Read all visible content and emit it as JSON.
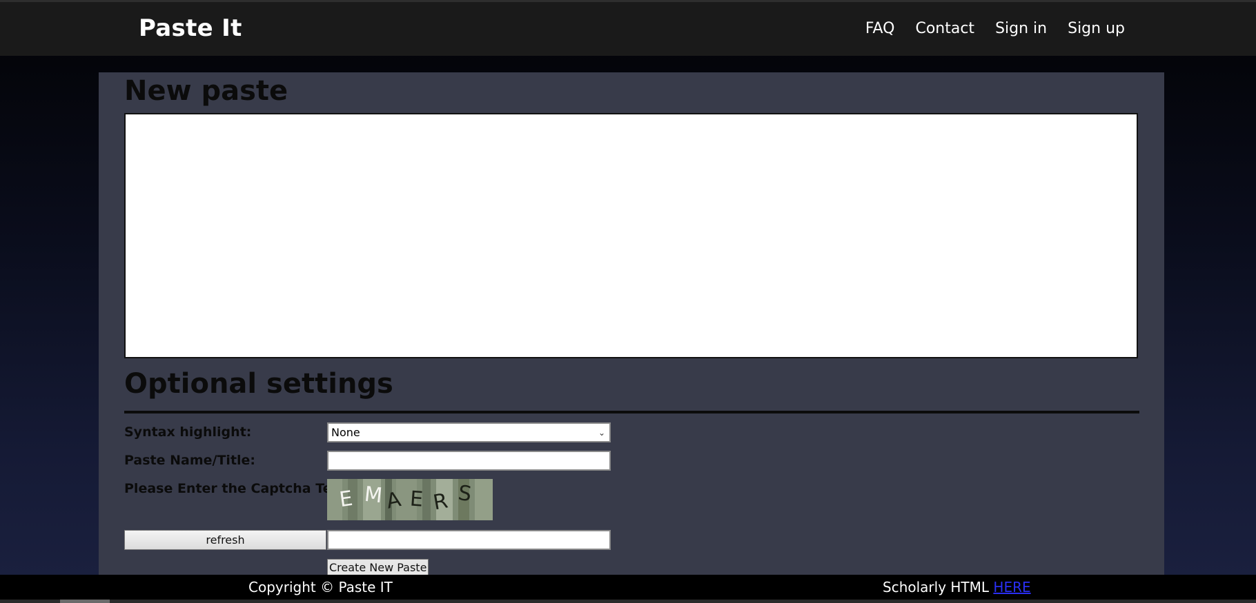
{
  "header": {
    "brand": "Paste It",
    "nav": [
      "FAQ",
      "Contact",
      "Sign in",
      "Sign up"
    ]
  },
  "main": {
    "title": "New paste",
    "paste_content": "",
    "optional_title": "Optional settings",
    "syntax_label": "Syntax highlight:",
    "syntax_value": "None",
    "name_label": "Paste Name/Title:",
    "name_value": "",
    "captcha_label": "Please Enter the Captcha Text",
    "captcha_text": "EMAERS",
    "captcha_chars": [
      "E",
      "M",
      "A",
      "E",
      "R",
      "S"
    ],
    "refresh_label": "refresh",
    "captcha_input_value": "",
    "create_label": "Create New Paste"
  },
  "footer": {
    "copyright": "Copyright © Paste IT",
    "scholarly_prefix": "Scholarly HTML ",
    "scholarly_link": "HERE"
  },
  "colors": {
    "header_bg": "#1a1a1a",
    "panel_bg": "#383b4a",
    "footer_bg": "#000000",
    "link": "#2a2ff5"
  }
}
